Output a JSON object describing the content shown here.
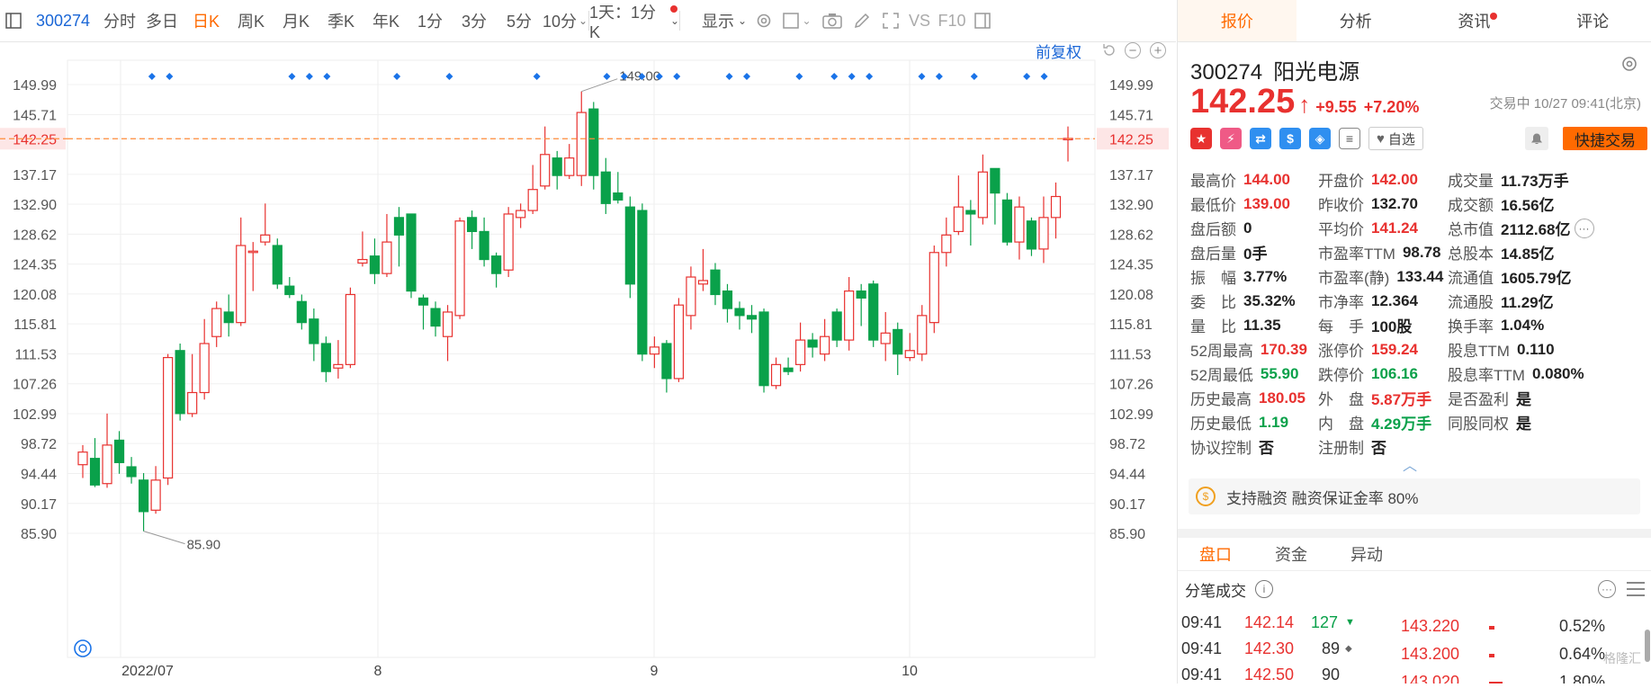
{
  "toolbar": {
    "code": "300274",
    "items": [
      "分时",
      "多日",
      "日K",
      "周K",
      "月K",
      "季K",
      "年K",
      "1分",
      "3分",
      "5分",
      "10分"
    ],
    "active_index": 2,
    "interval_select": "1天：1分K",
    "display_label": "显示",
    "vs_label": "VS",
    "f10_label": "F10"
  },
  "chart_controls": {
    "adjust_label": "前复权",
    "zoom_out": "−",
    "zoom_in": "+"
  },
  "chart_data": {
    "type": "candlestick",
    "y_ticks": [
      149.99,
      145.71,
      142.25,
      137.17,
      132.9,
      128.62,
      124.35,
      120.08,
      115.81,
      111.53,
      107.26,
      102.99,
      98.72,
      94.44,
      90.17,
      85.9
    ],
    "ylim": [
      85.9,
      149.99
    ],
    "current_price_line": 142.25,
    "high_label": "149.00",
    "low_label": "85.90",
    "x_labels": [
      "2022/07",
      "8",
      "9",
      "10"
    ],
    "colors": {
      "up": "#e8312f",
      "down": "#0aa14a",
      "marker": "#1a73e8",
      "price_line": "#ff8c3a"
    },
    "candles": [
      [
        95.7,
        97.5,
        98.5,
        93.8
      ],
      [
        96.6,
        92.8,
        99.5,
        92.5
      ],
      [
        93.0,
        98.5,
        103.0,
        92.4
      ],
      [
        99.2,
        96.0,
        100.5,
        94.4
      ],
      [
        95.4,
        94.0,
        96.8,
        93.0
      ],
      [
        93.5,
        89.0,
        94.5,
        86.2
      ],
      [
        89.2,
        93.5,
        95.5,
        88.7
      ],
      [
        93.8,
        111.0,
        111.5,
        92.8
      ],
      [
        112.0,
        103.0,
        113.0,
        102.0
      ],
      [
        103.0,
        106.0,
        111.5,
        102.5
      ],
      [
        106.0,
        113.0,
        116.5,
        105.0
      ],
      [
        114.0,
        118.0,
        119.0,
        112.5
      ],
      [
        117.5,
        116.0,
        120.0,
        114.0
      ],
      [
        116.0,
        127.0,
        131.0,
        115.5
      ],
      [
        126.0,
        126.2,
        127.5,
        120.5
      ],
      [
        127.5,
        128.5,
        133.0,
        127.0
      ],
      [
        127.0,
        121.5,
        128.0,
        120.8
      ],
      [
        121.2,
        120.0,
        122.5,
        119.5
      ],
      [
        119.0,
        116.0,
        120.0,
        115.0
      ],
      [
        116.5,
        113.0,
        118.0,
        110.5
      ],
      [
        113.0,
        109.0,
        114.0,
        107.5
      ],
      [
        109.5,
        110.0,
        113.5,
        108.0
      ],
      [
        110.0,
        120.0,
        121.0,
        109.5
      ],
      [
        124.5,
        125.0,
        129.0,
        124.0
      ],
      [
        125.5,
        123.0,
        128.0,
        121.5
      ],
      [
        123.0,
        127.5,
        131.5,
        122.5
      ],
      [
        131.0,
        128.5,
        132.5,
        124.0
      ],
      [
        131.5,
        120.5,
        131.5,
        119.5
      ],
      [
        119.5,
        118.5,
        120.0,
        115.0
      ],
      [
        118.0,
        115.5,
        119.0,
        114.0
      ],
      [
        114.0,
        117.5,
        118.5,
        110.5
      ],
      [
        117.0,
        130.5,
        131.0,
        116.5
      ],
      [
        131.0,
        129.0,
        132.0,
        126.5
      ],
      [
        129.0,
        125.0,
        131.0,
        124.0
      ],
      [
        125.5,
        123.0,
        126.0,
        121.0
      ],
      [
        123.5,
        131.5,
        132.5,
        122.5
      ],
      [
        131.0,
        132.0,
        133.0,
        129.5
      ],
      [
        132.0,
        135.0,
        138.5,
        131.5
      ],
      [
        135.5,
        140.0,
        144.0,
        135.0
      ],
      [
        139.5,
        137.0,
        140.5,
        135.0
      ],
      [
        137.0,
        139.5,
        141.5,
        136.5
      ],
      [
        137.0,
        146.0,
        149.0,
        135.5
      ],
      [
        146.5,
        137.0,
        147.5,
        135.0
      ],
      [
        137.5,
        133.0,
        139.5,
        131.5
      ],
      [
        134.5,
        133.5,
        137.5,
        133.0
      ],
      [
        132.5,
        121.5,
        134.0,
        119.5
      ],
      [
        132.0,
        111.5,
        133.0,
        110.5
      ],
      [
        111.5,
        112.5,
        114.0,
        109.5
      ],
      [
        113.0,
        108.0,
        113.5,
        106.0
      ],
      [
        108.0,
        118.5,
        119.5,
        107.5
      ],
      [
        117.0,
        122.5,
        124.0,
        115.0
      ],
      [
        121.5,
        122.0,
        126.5,
        120.5
      ],
      [
        123.5,
        120.0,
        124.5,
        118.5
      ],
      [
        120.5,
        118.0,
        121.5,
        116.0
      ],
      [
        118.0,
        117.0,
        119.0,
        115.0
      ],
      [
        117.0,
        116.5,
        118.5,
        114.5
      ],
      [
        117.5,
        107.0,
        118.0,
        106.0
      ],
      [
        107.0,
        110.0,
        111.0,
        106.5
      ],
      [
        109.5,
        109.0,
        111.0,
        108.5
      ],
      [
        110.0,
        113.5,
        116.0,
        109.0
      ],
      [
        113.5,
        112.5,
        114.5,
        111.0
      ],
      [
        111.5,
        114.0,
        116.5,
        110.5
      ],
      [
        117.5,
        113.5,
        118.0,
        112.5
      ],
      [
        113.5,
        120.5,
        122.5,
        112.0
      ],
      [
        120.5,
        119.5,
        121.5,
        115.5
      ],
      [
        121.5,
        113.5,
        122.0,
        112.5
      ],
      [
        113.0,
        114.5,
        117.5,
        110.5
      ],
      [
        115.0,
        111.5,
        116.0,
        108.5
      ],
      [
        111.0,
        112.0,
        114.5,
        110.5
      ],
      [
        111.5,
        117.0,
        118.5,
        110.5
      ],
      [
        116.0,
        126.0,
        127.0,
        114.5
      ],
      [
        126.0,
        128.5,
        131.0,
        124.0
      ],
      [
        129.0,
        132.5,
        137.0,
        128.5
      ],
      [
        132.0,
        131.5,
        133.5,
        127.0
      ],
      [
        131.0,
        137.5,
        140.0,
        130.0
      ],
      [
        138.0,
        134.5,
        138.0,
        130.0
      ],
      [
        133.5,
        127.5,
        134.5,
        127.0
      ],
      [
        127.5,
        132.5,
        134.0,
        125.0
      ],
      [
        130.5,
        126.5,
        131.0,
        125.5
      ],
      [
        126.5,
        131.0,
        134.0,
        124.5
      ],
      [
        131.0,
        134.0,
        136.0,
        128.0
      ],
      [
        142.25,
        142.3,
        144.0,
        139.0
      ]
    ],
    "marker_slots": [
      2,
      3,
      10,
      11,
      12,
      16,
      19,
      24,
      28,
      29,
      30,
      31,
      32,
      35,
      36,
      39,
      41,
      42,
      43,
      46,
      47,
      49,
      52,
      53
    ],
    "marker_slot_count": 55
  },
  "quote_tabs": [
    "报价",
    "分析",
    "资讯",
    "评论"
  ],
  "quote_active": 0,
  "stock": {
    "code": "300274",
    "name": "阳光电源",
    "price": "142.25",
    "change": "+9.55",
    "change_pct": "+7.20%",
    "status": "交易中 10/27 09:41(北京)",
    "zixuan": "自选",
    "quick_trade": "快捷交易"
  },
  "stats": [
    [
      {
        "k": "最高价",
        "v": "144.00",
        "c": "red"
      },
      {
        "k": "开盘价",
        "v": "142.00",
        "c": "red"
      },
      {
        "k": "成交量",
        "v": "11.73万手",
        "c": ""
      }
    ],
    [
      {
        "k": "最低价",
        "v": "139.00",
        "c": "red"
      },
      {
        "k": "昨收价",
        "v": "132.70",
        "c": ""
      },
      {
        "k": "成交额",
        "v": "16.56亿",
        "c": ""
      }
    ],
    [
      {
        "k": "盘后额",
        "v": "0",
        "c": ""
      },
      {
        "k": "平均价",
        "v": "141.24",
        "c": "red"
      },
      {
        "k": "总市值",
        "v": "2112.68亿",
        "c": "",
        "more": true
      }
    ],
    [
      {
        "k": "盘后量",
        "v": "0手",
        "c": ""
      },
      {
        "k": "市盈率TTM",
        "v": "98.78",
        "c": ""
      },
      {
        "k": "总股本",
        "v": "14.85亿",
        "c": ""
      }
    ],
    [
      {
        "k": "振　幅",
        "v": "3.77%",
        "c": ""
      },
      {
        "k": "市盈率(静)",
        "v": "133.44",
        "c": ""
      },
      {
        "k": "流通值",
        "v": "1605.79亿",
        "c": ""
      }
    ],
    [
      {
        "k": "委　比",
        "v": "35.32%",
        "c": ""
      },
      {
        "k": "市净率",
        "v": "12.364",
        "c": ""
      },
      {
        "k": "流通股",
        "v": "11.29亿",
        "c": ""
      }
    ],
    [
      {
        "k": "量　比",
        "v": "11.35",
        "c": ""
      },
      {
        "k": "每　手",
        "v": "100股",
        "c": ""
      },
      {
        "k": "换手率",
        "v": "1.04%",
        "c": ""
      }
    ],
    [
      {
        "k": "52周最高",
        "v": "170.39",
        "c": "red"
      },
      {
        "k": "涨停价",
        "v": "159.24",
        "c": "red"
      },
      {
        "k": "股息TTM",
        "v": "0.110",
        "c": ""
      }
    ],
    [
      {
        "k": "52周最低",
        "v": "55.90",
        "c": "green"
      },
      {
        "k": "跌停价",
        "v": "106.16",
        "c": "green"
      },
      {
        "k": "股息率TTM",
        "v": "0.080%",
        "c": ""
      }
    ],
    [
      {
        "k": "历史最高",
        "v": "180.05",
        "c": "red"
      },
      {
        "k": "外　盘",
        "v": "5.87万手",
        "c": "red"
      },
      {
        "k": "是否盈利",
        "v": "是",
        "c": ""
      }
    ],
    [
      {
        "k": "历史最低",
        "v": "1.19",
        "c": "green"
      },
      {
        "k": "内　盘",
        "v": "4.29万手",
        "c": "green"
      },
      {
        "k": "同股同权",
        "v": "是",
        "c": ""
      }
    ],
    [
      {
        "k": "协议控制",
        "v": "否",
        "c": ""
      },
      {
        "k": "注册制",
        "v": "否",
        "c": ""
      }
    ]
  ],
  "margin_text": "支持融资 融资保证金率 80%",
  "lower_tabs": [
    "盘口",
    "资金",
    "异动"
  ],
  "lower_active": 0,
  "ticks_title": "分笔成交",
  "ticks": [
    {
      "time": "09:41",
      "price": "142.14",
      "vol": "127",
      "dir": "down"
    },
    {
      "time": "09:41",
      "price": "142.30",
      "vol": "89",
      "dir": "flat"
    },
    {
      "time": "09:41",
      "price": "142.50",
      "vol": "90",
      "dir": ""
    }
  ],
  "orderbook": [
    {
      "price": "143.220",
      "pct": "0.52%"
    },
    {
      "price": "143.200",
      "pct": "0.64%"
    },
    {
      "price": "143.020",
      "pct": "1.80%"
    }
  ],
  "watermark": "格隆汇"
}
